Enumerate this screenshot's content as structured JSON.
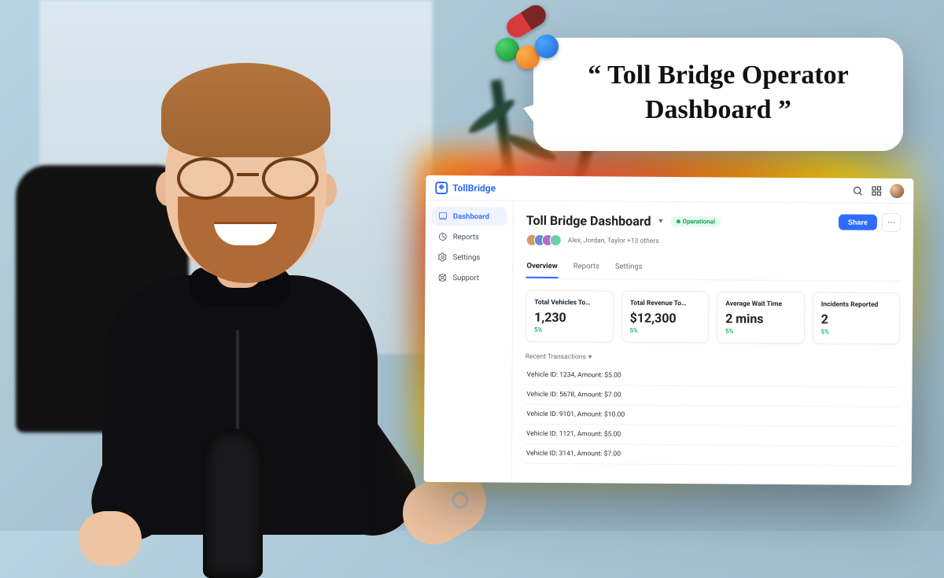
{
  "bubble": {
    "text": "“ Toll Bridge Operator Dashboard ”"
  },
  "product_name": "TollBridge",
  "sidebar": {
    "items": [
      {
        "label": "Dashboard",
        "active": true
      },
      {
        "label": "Reports",
        "active": false
      },
      {
        "label": "Settings",
        "active": false
      },
      {
        "label": "Support",
        "active": false
      }
    ]
  },
  "header": {
    "title": "Toll Bridge Dashboard",
    "status": "Operational",
    "share_label": "Share",
    "collaborators_text": "Alex, Jordan, Taylor +13 others"
  },
  "tabs": [
    {
      "label": "Overview",
      "active": true
    },
    {
      "label": "Reports",
      "active": false
    },
    {
      "label": "Settings",
      "active": false
    }
  ],
  "stats": [
    {
      "label": "Total Vehicles To…",
      "value": "1,230",
      "delta": "5%"
    },
    {
      "label": "Total Revenue To…",
      "value": "$12,300",
      "delta": "5%"
    },
    {
      "label": "Average Wait Time",
      "value": "2 mins",
      "delta": "5%"
    },
    {
      "label": "Incidents Reported",
      "value": "2",
      "delta": "5%"
    }
  ],
  "transactions_header": "Recent Transactions",
  "transactions": [
    "Vehicle ID: 1234, Amount: $5.00",
    "Vehicle ID: 5678, Amount: $7.00",
    "Vehicle ID: 9101, Amount: $10.00",
    "Vehicle ID: 1121, Amount: $5.00",
    "Vehicle ID: 3141, Amount: $7.00"
  ]
}
